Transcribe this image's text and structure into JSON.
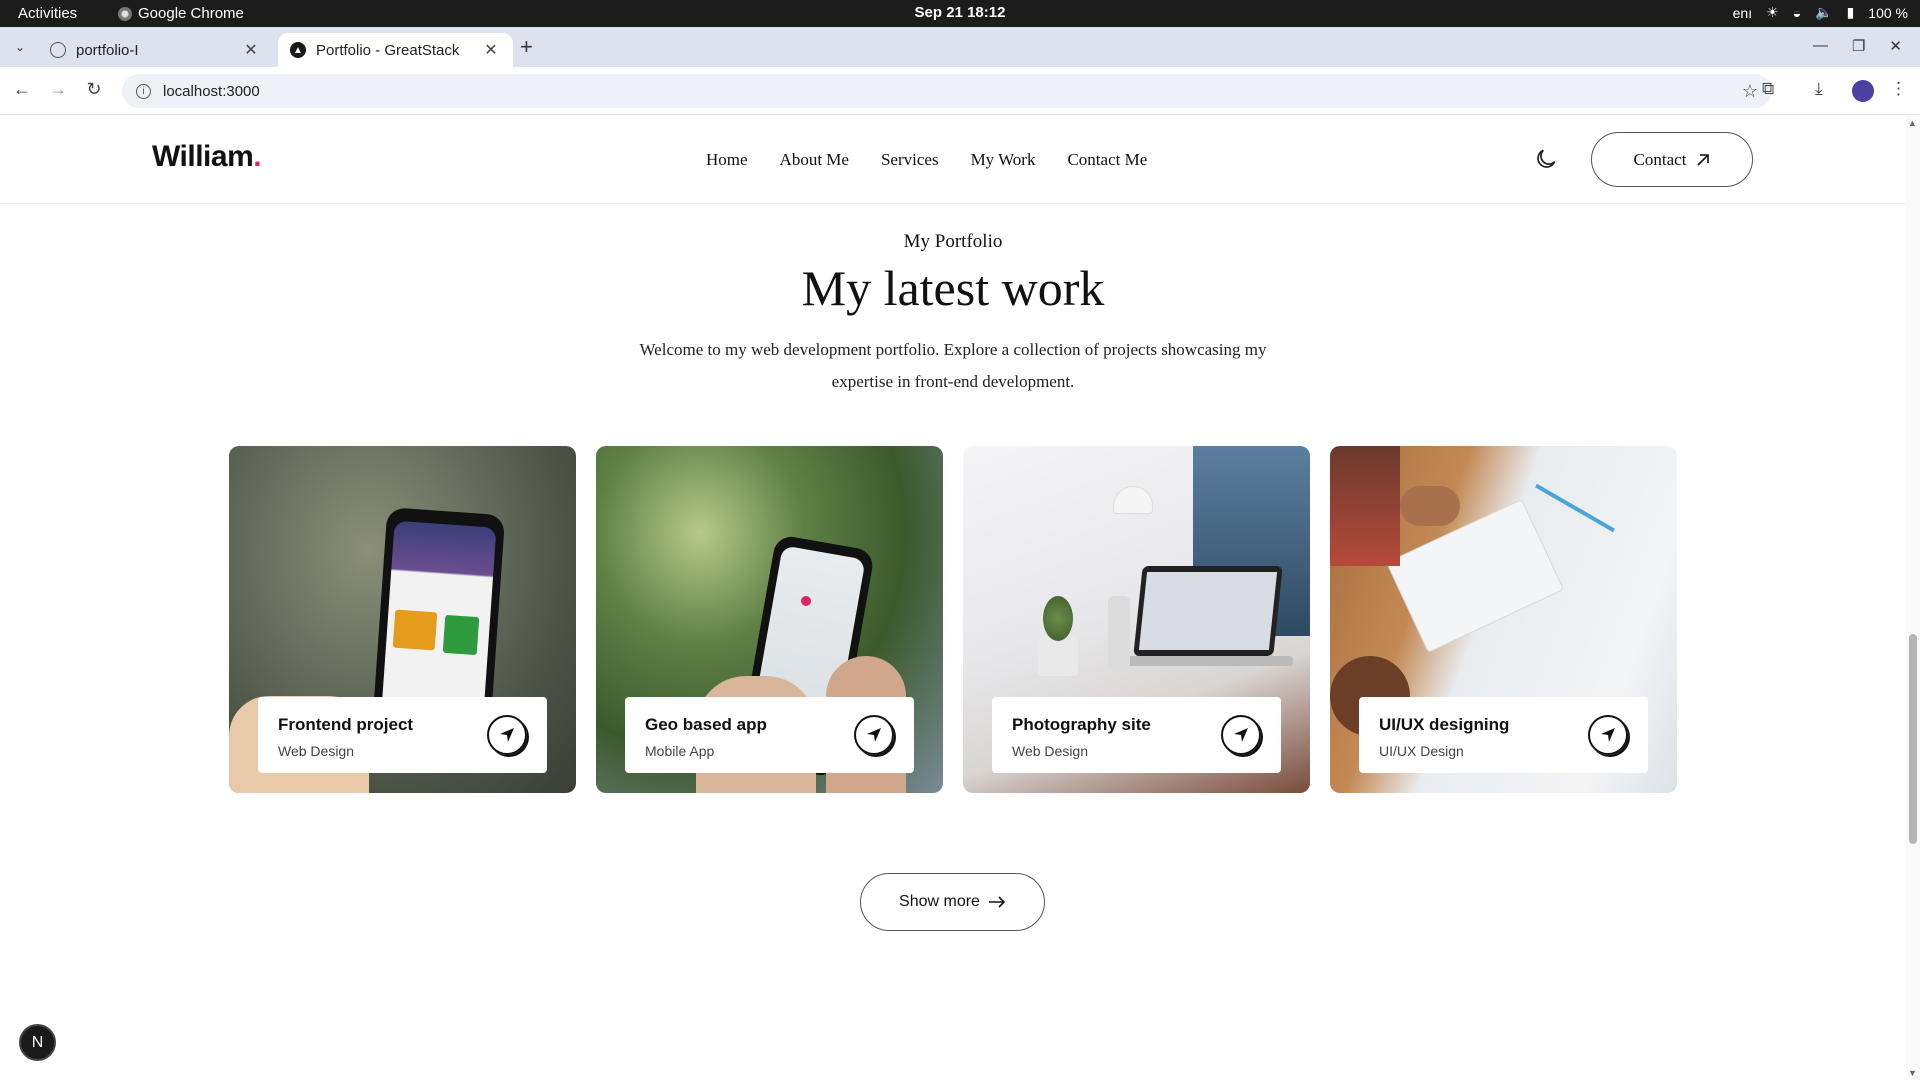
{
  "system": {
    "activities": "Activities",
    "app_name": "Google Chrome",
    "clock": "Sep 21  18:12",
    "lang": "enı",
    "battery": "100 %"
  },
  "browser": {
    "tabs": [
      {
        "title": "portfolio-I",
        "active": false
      },
      {
        "title": "Portfolio - GreatStack",
        "active": true
      }
    ],
    "url": "localhost:3000"
  },
  "site": {
    "logo": "William",
    "logo_dot": ".",
    "nav": [
      "Home",
      "About Me",
      "Services",
      "My Work",
      "Contact Me"
    ],
    "contact_label": "Contact"
  },
  "portfolio": {
    "subtitle": "My Portfolio",
    "title": "My latest work",
    "description": "Welcome to my web development portfolio. Explore a collection of projects showcasing my expertise in front-end development.",
    "projects": [
      {
        "title": "Frontend project",
        "category": "Web Design"
      },
      {
        "title": "Geo based app",
        "category": "Mobile App"
      },
      {
        "title": "Photography site",
        "category": "Web Design"
      },
      {
        "title": "UI/UX designing",
        "category": "UI/UX Design"
      }
    ],
    "show_more": "Show more"
  },
  "dev_badge": "N",
  "colors": {
    "accent_dot": "#e0245e",
    "profile": "#4b3fa0"
  }
}
